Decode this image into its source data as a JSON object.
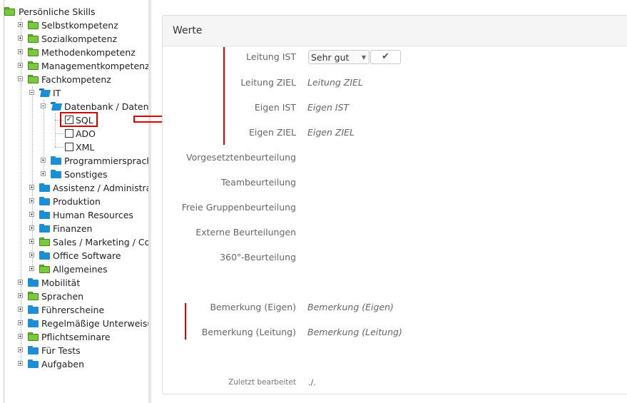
{
  "tree": {
    "root": "Persönliche Skills",
    "items": [
      {
        "label": "Selbstkompetenz"
      },
      {
        "label": "Sozialkompetenz"
      },
      {
        "label": "Methodenkompetenz"
      },
      {
        "label": "Managementkompetenz"
      },
      {
        "label": "Fachkompetenz"
      },
      {
        "label": "IT"
      },
      {
        "label": "Datenbank / Datenspeicherung"
      },
      {
        "label": "SQL",
        "checked": true
      },
      {
        "label": "ADO",
        "checked": false
      },
      {
        "label": "XML",
        "checked": false
      },
      {
        "label": "Programmiersprachen"
      },
      {
        "label": "Sonstiges"
      },
      {
        "label": "Assistenz / Administration"
      },
      {
        "label": "Produktion"
      },
      {
        "label": "Human Resources"
      },
      {
        "label": "Finanzen"
      },
      {
        "label": "Sales / Marketing / Communication"
      },
      {
        "label": "Office Software"
      },
      {
        "label": "Allgemeines"
      },
      {
        "label": "Mobilität"
      },
      {
        "label": "Sprachen"
      },
      {
        "label": "Führerscheine"
      },
      {
        "label": "Regelmäßige Unterweisungen"
      },
      {
        "label": "Pflichtseminare"
      },
      {
        "label": "Für Tests"
      },
      {
        "label": "Aufgaben"
      }
    ]
  },
  "form": {
    "title": "Werte",
    "rows": [
      {
        "label": "Leitung IST",
        "value": ""
      },
      {
        "label": "Leitung ZIEL",
        "value": "Leitung ZIEL"
      },
      {
        "label": "Eigen IST",
        "value": "Eigen IST"
      },
      {
        "label": "Eigen ZIEL",
        "value": "Eigen ZIEL"
      },
      {
        "label": "Vorgesetztenbeurteilung",
        "value": ""
      },
      {
        "label": "Teambeurteilung",
        "value": ""
      },
      {
        "label": "Freie Gruppenbeurteilung",
        "value": ""
      },
      {
        "label": "Externe Beurteilungen",
        "value": ""
      },
      {
        "label": "360°-Beurteilung",
        "value": ""
      },
      {
        "label": "Bemerkung (Eigen)",
        "value": "Bemerkung (Eigen)"
      },
      {
        "label": "Bemerkung (Leitung)",
        "value": "Bemerkung (Leitung)"
      }
    ],
    "leitung_ist_select": "Sehr gut",
    "confirm_icon": "check-icon",
    "footer_label": "Zuletzt bearbeitet",
    "footer_value": "./."
  },
  "colors": {
    "annotation_red": "#e00000",
    "folder_blue": "#1a8fd6",
    "folder_green": "#7cc83c"
  }
}
